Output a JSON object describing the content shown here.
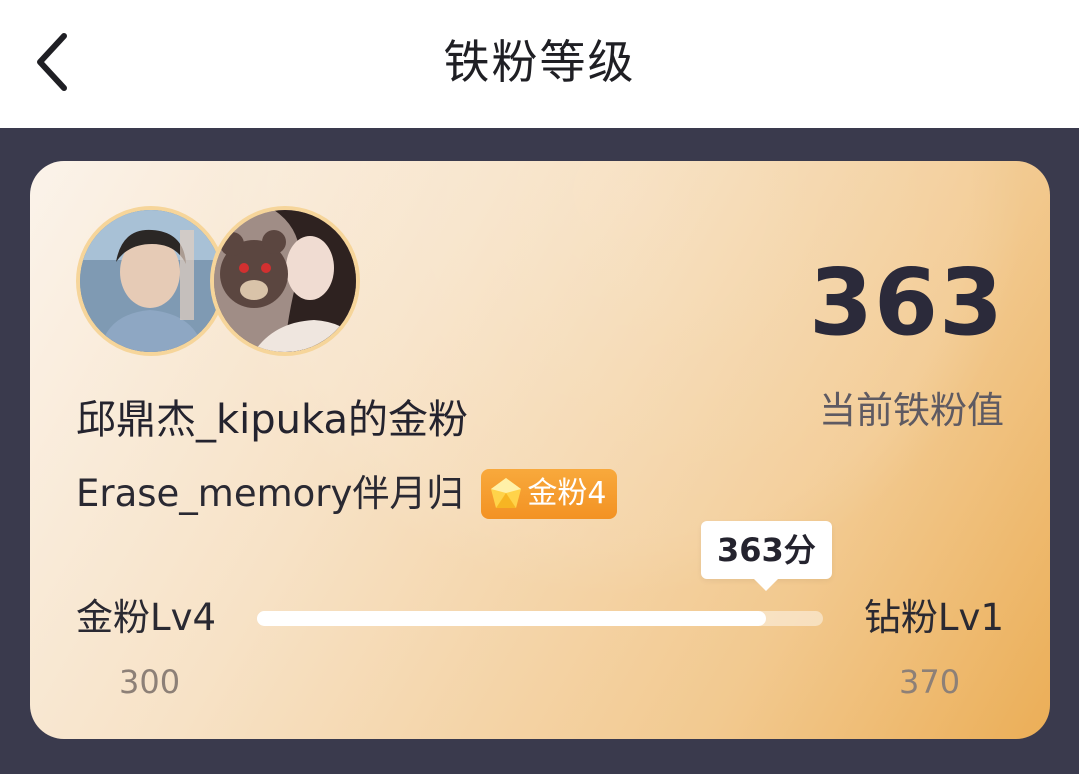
{
  "header": {
    "title": "铁粉等级",
    "back_icon": "chevron-left-icon"
  },
  "card": {
    "fan_value": "363",
    "fan_value_label": "当前铁粉值",
    "fan_group_name": "邱鼎杰_kipuka的金粉",
    "user_name": "Erase_memory伴月归",
    "badge": {
      "icon": "diamond-gem-icon",
      "label": "金粉4",
      "color": "#f39223"
    },
    "progress": {
      "current_level": "金粉Lv4",
      "next_level": "钻粉Lv1",
      "min": "300",
      "max": "370",
      "current_label": "363分",
      "value": 363,
      "fill_fraction": 0.9
    }
  },
  "colors": {
    "page_background": "#3a3a4d",
    "header_background": "#ffffff",
    "card_gradient_start": "#fbf3ea",
    "card_gradient_end": "#ebae57",
    "primary_text": "#2b2a3a",
    "muted_text": "#8d8077"
  }
}
